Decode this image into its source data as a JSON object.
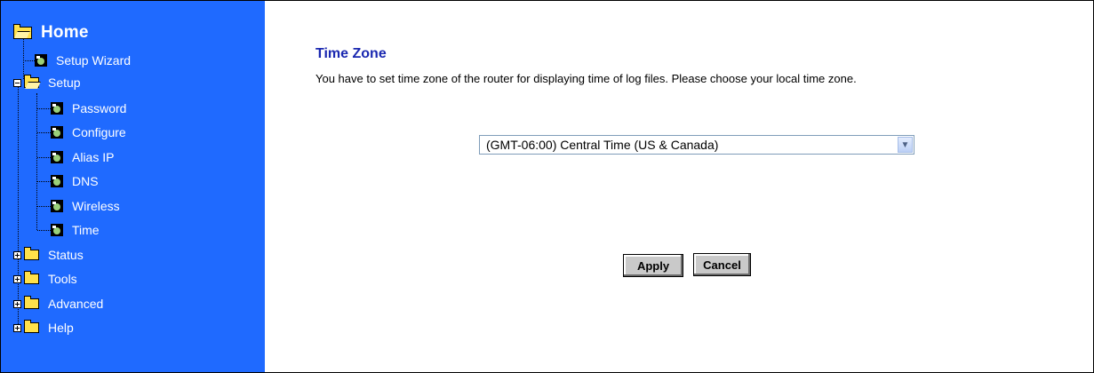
{
  "sidebar": {
    "home": "Home",
    "items": [
      {
        "label": "Setup Wizard"
      },
      {
        "label": "Setup"
      },
      {
        "label": "Password"
      },
      {
        "label": "Configure"
      },
      {
        "label": "Alias IP"
      },
      {
        "label": "DNS"
      },
      {
        "label": "Wireless"
      },
      {
        "label": "Time"
      },
      {
        "label": "Status"
      },
      {
        "label": "Tools"
      },
      {
        "label": "Advanced"
      },
      {
        "label": "Help"
      }
    ]
  },
  "main": {
    "title": "Time Zone",
    "description": "You have to set time zone of the router for displaying time of log files.  Please choose your local time zone.",
    "timezone_select": {
      "value": "(GMT-06:00) Central Time (US & Canada)"
    },
    "apply_label": "Apply",
    "cancel_label": "Cancel"
  },
  "colors": {
    "sidebar_bg": "#1f6aff",
    "title": "#1a28b0"
  }
}
